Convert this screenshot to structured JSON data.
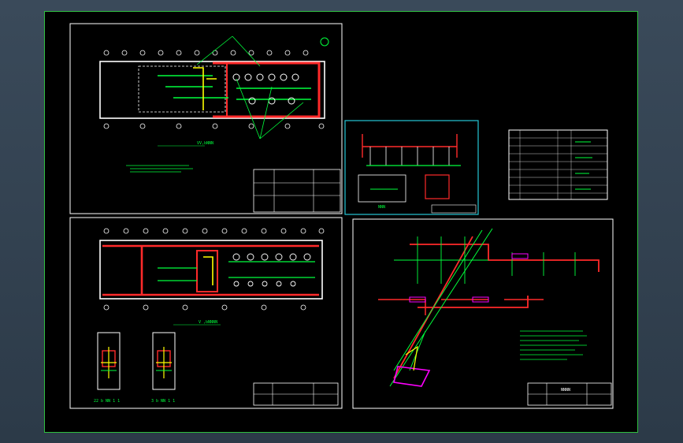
{
  "drawing": {
    "sheets": [
      {
        "name": "plan-top",
        "title_label": "VV,bNNN"
      },
      {
        "name": "plan-bottom",
        "title_label": "V ,bNNNN"
      },
      {
        "name": "detail-small",
        "title_label": "NNN"
      },
      {
        "name": "isometric",
        "title_label": "NNNN"
      }
    ],
    "small_plans": [
      {
        "label": "22 b NN 1 1"
      },
      {
        "label": "3 b NN 1 1"
      }
    ],
    "colors": {
      "frame": "#ffffff",
      "border": "#2fbf3f",
      "walls": "#ff2a2a",
      "lines": "#00ff3c",
      "accent": "#ffff00",
      "highlight": "#ff00ff",
      "detail_frame": "#25c6d6"
    }
  }
}
